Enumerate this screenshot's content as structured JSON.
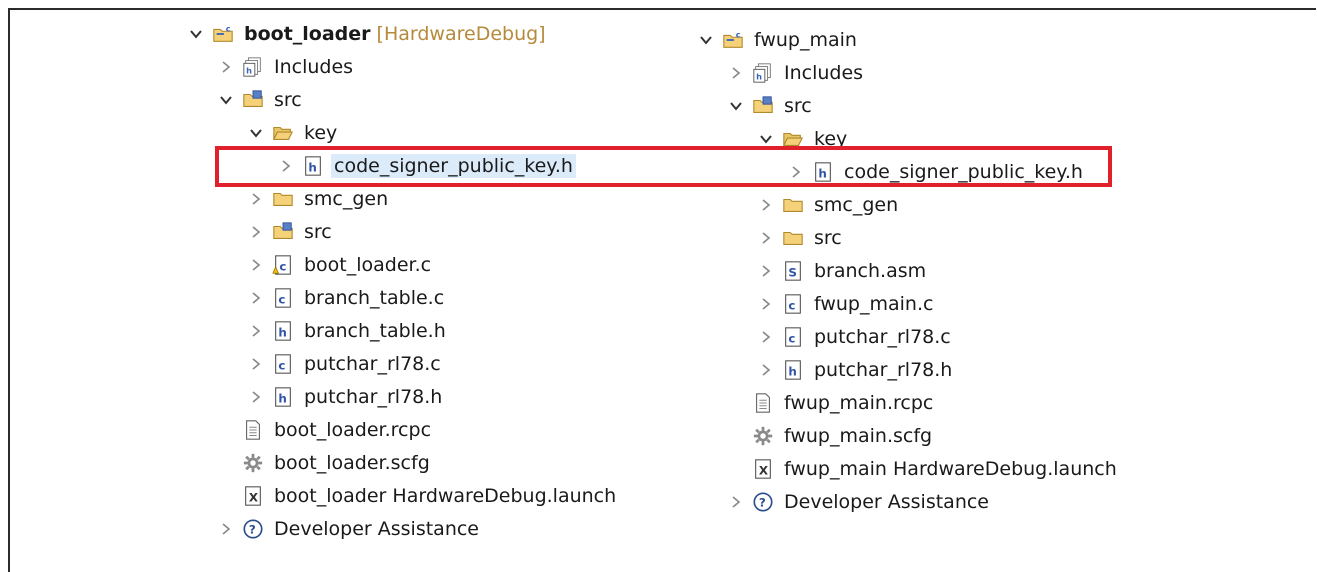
{
  "left_tree": {
    "items": [
      {
        "name": "boot-loader-project",
        "label": "boot_loader",
        "suffix": "[HardwareDebug]",
        "icon": "project-icon",
        "chevron": "down",
        "level": 0,
        "bold": true
      },
      {
        "name": "includes-folder",
        "label": "Includes",
        "icon": "includes-icon",
        "chevron": "right",
        "level": 1
      },
      {
        "name": "src-folder",
        "label": "src",
        "icon": "source-folder-icon",
        "chevron": "down",
        "level": 1
      },
      {
        "name": "key-folder",
        "label": "key",
        "icon": "open-folder-icon",
        "chevron": "down",
        "level": 2
      },
      {
        "name": "code-signer-public-key-h",
        "label": "code_signer_public_key.h",
        "icon": "header-file-icon",
        "chevron": "right",
        "level": 3,
        "selected": true
      },
      {
        "name": "smc-gen-folder",
        "label": "smc_gen",
        "icon": "folder-icon",
        "chevron": "right",
        "level": 2
      },
      {
        "name": "src-subfolder",
        "label": "src",
        "icon": "source-folder-icon",
        "chevron": "right",
        "level": 2
      },
      {
        "name": "boot-loader-c",
        "label": "boot_loader.c",
        "icon": "c-file-warning-icon",
        "chevron": "right",
        "level": 2
      },
      {
        "name": "branch-table-c",
        "label": "branch_table.c",
        "icon": "c-file-icon",
        "chevron": "right",
        "level": 2
      },
      {
        "name": "branch-table-h",
        "label": "branch_table.h",
        "icon": "header-file-icon",
        "chevron": "right",
        "level": 2
      },
      {
        "name": "putchar-rl78-c",
        "label": "putchar_rl78.c",
        "icon": "c-file-icon",
        "chevron": "right",
        "level": 2
      },
      {
        "name": "putchar-rl78-h",
        "label": "putchar_rl78.h",
        "icon": "header-file-icon",
        "chevron": "right",
        "level": 2
      },
      {
        "name": "boot-loader-rcpc",
        "label": "boot_loader.rcpc",
        "icon": "text-file-icon",
        "chevron": "none",
        "level": 1
      },
      {
        "name": "boot-loader-scfg",
        "label": "boot_loader.scfg",
        "icon": "gear-icon",
        "chevron": "none",
        "level": 1
      },
      {
        "name": "boot-loader-launch",
        "label": "boot_loader HardwareDebug.launch",
        "icon": "launch-file-icon",
        "chevron": "none",
        "level": 1
      },
      {
        "name": "developer-assistance",
        "label": "Developer Assistance",
        "icon": "help-icon",
        "chevron": "right",
        "level": 1
      }
    ]
  },
  "right_tree": {
    "items": [
      {
        "name": "fwup-main-project",
        "label": "fwup_main",
        "icon": "project-icon",
        "chevron": "down",
        "level": 0
      },
      {
        "name": "includes-folder",
        "label": "Includes",
        "icon": "includes-icon",
        "chevron": "right",
        "level": 1
      },
      {
        "name": "src-folder",
        "label": "src",
        "icon": "source-folder-icon",
        "chevron": "down",
        "level": 1
      },
      {
        "name": "key-folder",
        "label": "key",
        "icon": "open-folder-icon",
        "chevron": "down",
        "level": 2
      },
      {
        "name": "code-signer-public-key-h",
        "label": "code_signer_public_key.h",
        "icon": "header-file-icon",
        "chevron": "right",
        "level": 3
      },
      {
        "name": "smc-gen-folder",
        "label": "smc_gen",
        "icon": "folder-icon",
        "chevron": "right",
        "level": 2
      },
      {
        "name": "src-subfolder",
        "label": "src",
        "icon": "folder-icon",
        "chevron": "right",
        "level": 2
      },
      {
        "name": "branch-asm",
        "label": "branch.asm",
        "icon": "asm-file-icon",
        "chevron": "right",
        "level": 2
      },
      {
        "name": "fwup-main-c",
        "label": "fwup_main.c",
        "icon": "c-file-icon",
        "chevron": "right",
        "level": 2
      },
      {
        "name": "putchar-rl78-c",
        "label": "putchar_rl78.c",
        "icon": "c-file-icon",
        "chevron": "right",
        "level": 2
      },
      {
        "name": "putchar-rl78-h",
        "label": "putchar_rl78.h",
        "icon": "header-file-icon",
        "chevron": "right",
        "level": 2
      },
      {
        "name": "fwup-main-rcpc",
        "label": "fwup_main.rcpc",
        "icon": "text-file-icon",
        "chevron": "none",
        "level": 1
      },
      {
        "name": "fwup-main-scfg",
        "label": "fwup_main.scfg",
        "icon": "gear-icon",
        "chevron": "none",
        "level": 1
      },
      {
        "name": "fwup-main-launch",
        "label": "fwup_main HardwareDebug.launch",
        "icon": "launch-file-icon",
        "chevron": "none",
        "level": 1
      },
      {
        "name": "developer-assistance",
        "label": "Developer Assistance",
        "icon": "help-icon",
        "chevron": "right",
        "level": 1
      }
    ]
  },
  "colors": {
    "highlight_border": "#e0202a",
    "selection_bg": "#dcebfa",
    "folder_fill": "#f5d27a",
    "suffix_text": "#b58a3a"
  }
}
